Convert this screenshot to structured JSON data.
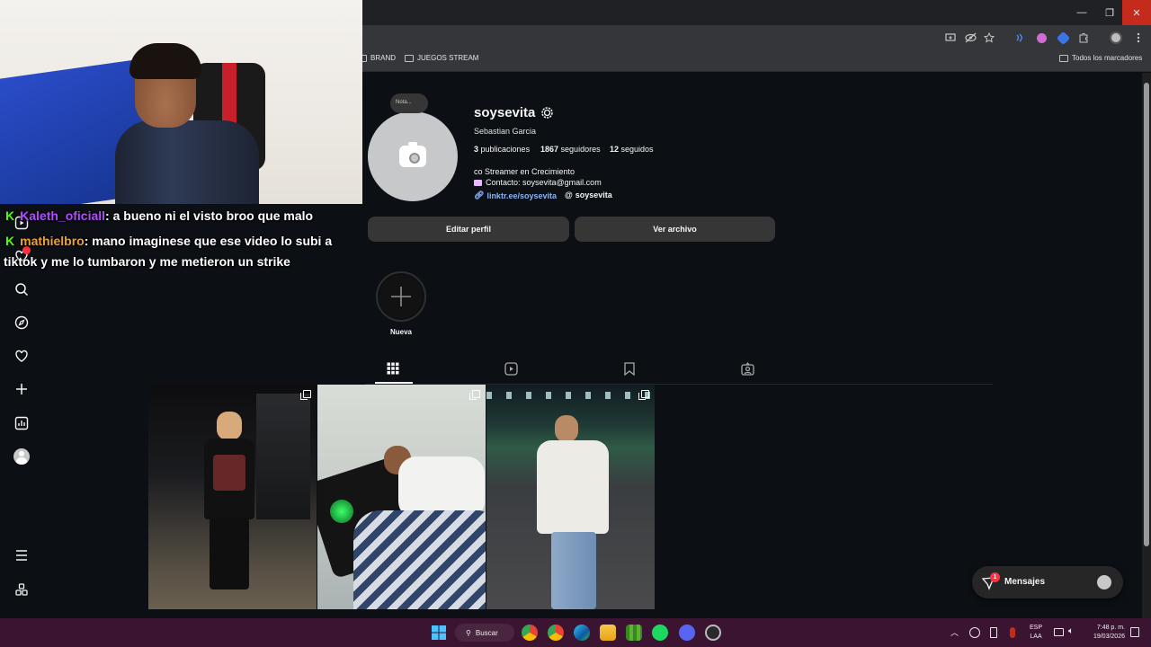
{
  "window": {
    "close_icon": "✕",
    "max_icon": "❐",
    "min_icon": "—"
  },
  "bookmarks": {
    "brand": "BRAND",
    "juegos": "JUEGOS STREAM",
    "all": "Todos los marcadores"
  },
  "chat": [
    {
      "user": "Kaleth_oficiall",
      "user_color": "#b14cff",
      "message": ": a bueno ni el visto broo que malo"
    },
    {
      "user": "mathielbro",
      "user_color": "#e9a23b",
      "message": ": mano imaginese que ese video lo subi a",
      "message_cont": "tiktok y me lo tumbaron y me metieron un strike"
    }
  ],
  "profile": {
    "note": "Nota...",
    "username": "soysevita",
    "full_name": "Sebastian Garcia",
    "posts_count": "3",
    "posts_label": "publicaciones",
    "followers_count": "1867",
    "followers_label": "seguidores",
    "following_count": "12",
    "following_label": "seguidos",
    "bio_line1": "co Streamer en Crecimiento",
    "bio_line2": "Contacto: soysevita@gmail.com",
    "link": "linktr.ee/soysevita",
    "threads": "soysevita",
    "edit_button": "Editar perfil",
    "archive_button": "Ver archivo",
    "new_highlight": "Nueva"
  },
  "messages": {
    "label": "Mensajes",
    "badge": "1"
  },
  "taskbar": {
    "search": "Buscar",
    "lang1": "ESP",
    "lang2": "LAA",
    "time": "7:48 p. m.",
    "date": "19/03/2026"
  },
  "colors": {
    "accent_link": "#8ab4f8",
    "kick_green": "#53fc18",
    "ig_bg": "#0c1014",
    "badge_red": "#ff3040"
  }
}
